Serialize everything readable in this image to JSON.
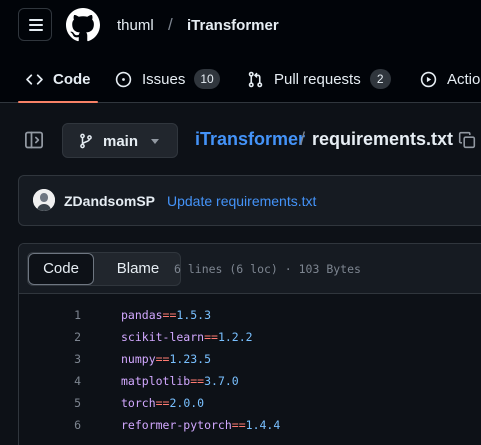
{
  "header": {
    "owner": "thuml",
    "separator": "/",
    "repo": "iTransformer"
  },
  "tabs": {
    "code": "Code",
    "issues": "Issues",
    "issues_count": "10",
    "pull_requests": "Pull requests",
    "pull_requests_count": "2",
    "actions": "Actions"
  },
  "file_header": {
    "branch": "main",
    "repo_link": "iTransformer",
    "separator": "/",
    "file_name": "requirements.txt"
  },
  "commit": {
    "author": "ZDandsomSP",
    "message": "Update requirements.txt"
  },
  "code_view": {
    "code_tab": "Code",
    "blame_tab": "Blame",
    "file_info": "6 lines (6 loc) · 103 Bytes",
    "lines": [
      {
        "num": "1",
        "pkg": "pandas",
        "op": "==",
        "ver": "1.5.3"
      },
      {
        "num": "2",
        "pkg": "scikit-learn",
        "op": "==",
        "ver": "1.2.2"
      },
      {
        "num": "3",
        "pkg": "numpy",
        "op": "==",
        "ver": "1.23.5"
      },
      {
        "num": "4",
        "pkg": "matplotlib",
        "op": "==",
        "ver": "3.7.0"
      },
      {
        "num": "5",
        "pkg": "torch",
        "op": "==",
        "ver": "2.0.0"
      },
      {
        "num": "6",
        "pkg": "reformer-pytorch",
        "op": "==",
        "ver": "1.4.4"
      }
    ]
  },
  "colors": {
    "accent_link": "#4493f8",
    "tab_underline": "#f78166",
    "package": "#d2a8ff",
    "operator": "#ff7b72",
    "version": "#79c0ff"
  }
}
